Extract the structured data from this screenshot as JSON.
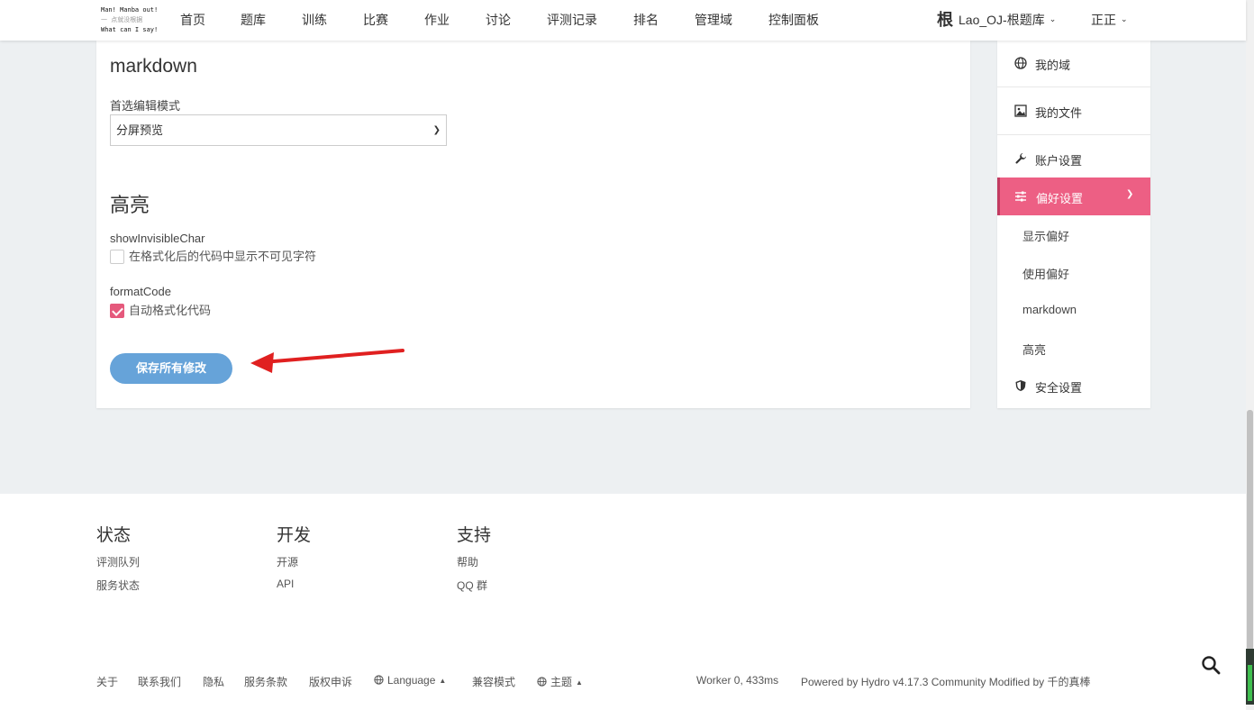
{
  "header": {
    "logo_lines": [
      "Man! Manba out!",
      "一 点就没根据",
      "What can I say!"
    ],
    "nav": [
      "首页",
      "题库",
      "训练",
      "比赛",
      "作业",
      "讨论",
      "评测记录",
      "排名",
      "管理域",
      "控制面板"
    ],
    "domain_glyph": "根",
    "domain_name": "Lao_OJ-根题库",
    "user_name": "正正"
  },
  "main": {
    "markdown_title": "markdown",
    "edit_mode_label": "首选编辑模式",
    "edit_mode_value": "分屏预览",
    "highlight_title": "高亮",
    "show_invisible": {
      "key": "showInvisibleChar",
      "label": "在格式化后的代码中显示不可见字符",
      "checked": false
    },
    "format_code": {
      "key": "formatCode",
      "label": "自动格式化代码",
      "checked": true
    },
    "save_label": "保存所有修改"
  },
  "sidebar": {
    "items": [
      {
        "label": "我的域",
        "icon": "globe-icon"
      },
      {
        "label": "我的文件",
        "icon": "image-icon"
      },
      {
        "label": "账户设置",
        "icon": "wrench-icon"
      },
      {
        "label": "偏好设置",
        "icon": "sliders-icon",
        "active": true
      },
      {
        "label": "安全设置",
        "icon": "shield-icon"
      }
    ],
    "sub_items": [
      "显示偏好",
      "使用偏好",
      "markdown",
      "高亮"
    ]
  },
  "footer": {
    "columns": [
      {
        "title": "状态",
        "links": [
          "评测队列",
          "服务状态"
        ]
      },
      {
        "title": "开发",
        "links": [
          "开源",
          "API"
        ]
      },
      {
        "title": "支持",
        "links": [
          "帮助",
          "QQ 群"
        ]
      }
    ],
    "bottom_links": [
      "关于",
      "联系我们",
      "隐私",
      "服务条款",
      "版权申诉"
    ],
    "language_label": "Language",
    "compat_label": "兼容模式",
    "theme_label": "主题",
    "worker_info": "Worker 0, 433ms",
    "powered_by": "Powered by Hydro v4.17.3 Community Modified by 千的真棒"
  },
  "colors": {
    "accent": "#ed5f84",
    "save_button": "#66a3d9",
    "arrow": "#e02020"
  }
}
